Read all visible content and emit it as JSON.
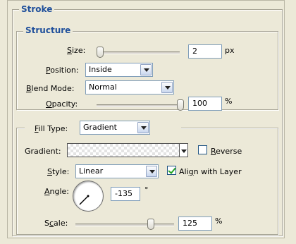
{
  "stroke": {
    "title": "Stroke",
    "structure": {
      "title": "Structure",
      "size": {
        "label": "Size:",
        "accel": "S",
        "value": "2",
        "unit": "px",
        "slider_fraction": 0.01
      },
      "position": {
        "label": "Position:",
        "accel": "P",
        "selected": "Inside"
      },
      "blend_mode": {
        "label": "Blend Mode:",
        "accel": "B",
        "selected": "Normal"
      },
      "opacity": {
        "label": "Opacity:",
        "accel": "O",
        "value": "100",
        "unit": "%",
        "slider_fraction": 1.0
      }
    },
    "fill": {
      "fill_type": {
        "label": "Fill Type:",
        "accel": "F",
        "selected": "Gradient"
      },
      "gradient": {
        "label": "Gradient:",
        "reverse_label": "Reverse",
        "reverse_checked": false
      },
      "style": {
        "label": "Style:",
        "accel": "S",
        "selected": "Linear"
      },
      "align": {
        "label": "Align with Layer",
        "checked": true
      },
      "angle": {
        "label": "Angle:",
        "accel": "A",
        "value": "-135",
        "unit": "°"
      },
      "scale": {
        "label": "Scale:",
        "accel": "c",
        "value": "125",
        "unit": "%",
        "slider_fraction": 0.83
      }
    }
  }
}
